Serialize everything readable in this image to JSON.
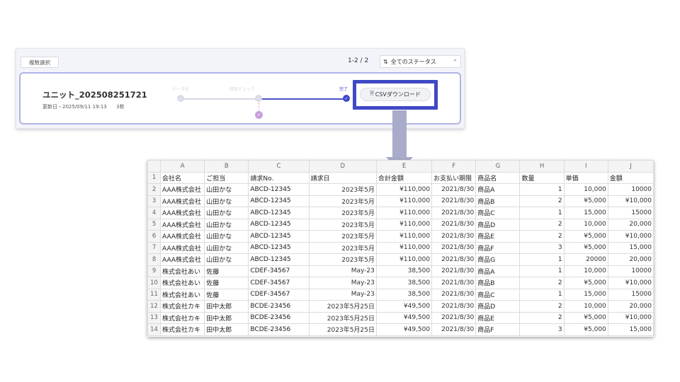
{
  "app": {
    "multi_select_label": "複数選択",
    "pagination": "1-2 / 2",
    "status_filter_label": "全てのステータス",
    "unit": {
      "title": "ユニット_202508251721",
      "updated": "更新日・2025/09/11 19:13",
      "count": "3枚"
    },
    "steps": [
      {
        "label": "データ化",
        "state": "done"
      },
      {
        "label": "読取チェック",
        "state": "done"
      },
      {
        "label": "完了",
        "state": "current"
      }
    ],
    "csv_button_label": "CSVダウンロード"
  },
  "sheet": {
    "columns": [
      "A",
      "B",
      "C",
      "D",
      "E",
      "F",
      "G",
      "H",
      "I",
      "J"
    ],
    "row_numbers": [
      "1",
      "2",
      "3",
      "4",
      "5",
      "6",
      "7",
      "8",
      "9",
      "10",
      "11",
      "12",
      "13",
      "14"
    ],
    "rows": [
      [
        "会社名",
        "ご担当",
        "請求No.",
        "請求日",
        "合計金額",
        "お支払い期限",
        "商品名",
        "数量",
        "単価",
        "金額"
      ],
      [
        "AAA株式会社",
        "山田かな",
        "ABCD-12345",
        "2023年5月",
        "¥110,000",
        "2021/8/30",
        "商品A",
        "1",
        "10,000",
        "10000"
      ],
      [
        "AAA株式会社",
        "山田かな",
        "ABCD-12345",
        "2023年5月",
        "¥110,000",
        "2021/8/30",
        "商品B",
        "2",
        "¥5,000",
        "¥10,000"
      ],
      [
        "AAA株式会社",
        "山田かな",
        "ABCD-12345",
        "2023年5月",
        "¥110,000",
        "2021/8/30",
        "商品C",
        "1",
        "15,000",
        "15000"
      ],
      [
        "AAA株式会社",
        "山田かな",
        "ABCD-12345",
        "2023年5月",
        "¥110,000",
        "2021/8/30",
        "商品D",
        "2",
        "10,000",
        "20,000"
      ],
      [
        "AAA株式会社",
        "山田かな",
        "ABCD-12345",
        "2023年5月",
        "¥110,000",
        "2021/8/30",
        "商品E",
        "2",
        "¥5,000",
        "¥10,000"
      ],
      [
        "AAA株式会社",
        "山田かな",
        "ABCD-12345",
        "2023年5月",
        "¥110,000",
        "2021/8/30",
        "商品F",
        "3",
        "¥5,000",
        "15,000"
      ],
      [
        "AAA株式会社",
        "山田かな",
        "ABCD-12345",
        "2023年5月",
        "¥110,000",
        "2021/8/30",
        "商品G",
        "1",
        "20000",
        "20,000"
      ],
      [
        "株式会社あい",
        "佐藤",
        "CDEF-34567",
        "May-23",
        "38,500",
        "2021/8/30",
        "商品A",
        "1",
        "10,000",
        "10000"
      ],
      [
        "株式会社あい",
        "佐藤",
        "CDEF-34567",
        "May-23",
        "38,500",
        "2021/8/30",
        "商品B",
        "2",
        "¥5,000",
        "¥10,000"
      ],
      [
        "株式会社あい",
        "佐藤",
        "CDEF-34567",
        "May-23",
        "38,500",
        "2021/8/30",
        "商品C",
        "1",
        "15,000",
        "15000"
      ],
      [
        "株式会社カキ",
        "田中太郎",
        "BCDE-23456",
        "2023年5月25日",
        "¥49,500",
        "2021/8/30",
        "商品D",
        "2",
        "10,000",
        "20,000"
      ],
      [
        "株式会社カキ",
        "田中太郎",
        "BCDE-23456",
        "2023年5月25日",
        "¥49,500",
        "2021/8/30",
        "商品E",
        "2",
        "¥5,000",
        "¥10,000"
      ],
      [
        "株式会社カキ",
        "田中太郎",
        "BCDE-23456",
        "2023年5月25日",
        "¥49,500",
        "2021/8/30",
        "商品F",
        "3",
        "¥5,000",
        "15,000"
      ]
    ]
  }
}
